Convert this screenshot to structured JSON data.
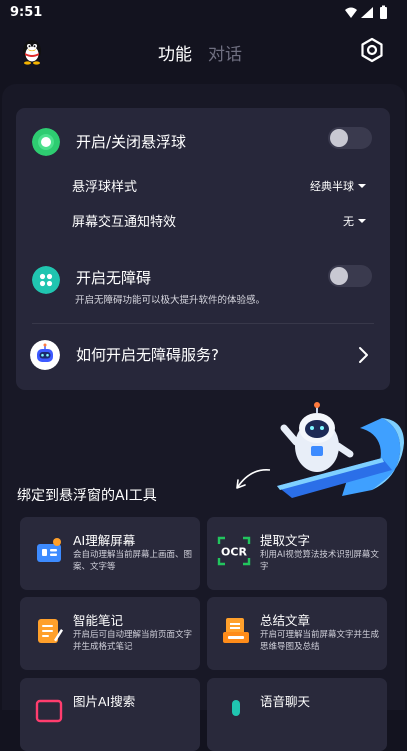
{
  "status_bar": {
    "time": "9:51"
  },
  "header": {
    "tab_function": "功能",
    "tab_chat": "对话"
  },
  "settings": {
    "floating_ball": {
      "title": "开启/关闭悬浮球",
      "enabled": false,
      "style_label": "悬浮球样式",
      "style_value": "经典半球",
      "effect_label": "屏幕交互通知特效",
      "effect_value": "无"
    },
    "accessibility": {
      "title": "开启无障碍",
      "enabled": false,
      "description": "开启无障碍功能可以极大提升软件的体验感。"
    },
    "help": {
      "title": "如何开启无障碍服务?"
    }
  },
  "tools_section": {
    "title": "绑定到悬浮窗的AI工具",
    "items": [
      {
        "name": "AI理解屏幕",
        "desc": "会自动理解当前屏幕上画面、图案、文字等",
        "icon": "screen-understand-icon"
      },
      {
        "name": "提取文字",
        "desc": "利用AI视觉算法技术识别屏幕文字",
        "icon": "ocr-icon",
        "icon_text": "OCR"
      },
      {
        "name": "智能笔记",
        "desc": "开启后可自动理解当前页面文字并生成格式笔记",
        "icon": "note-icon"
      },
      {
        "name": "总结文章",
        "desc": "开启可理解当前屏幕文字并生成思维导图及总结",
        "icon": "summary-icon"
      },
      {
        "name": "图片AI搜索",
        "desc": "",
        "icon": "image-search-icon"
      },
      {
        "name": "语音聊天",
        "desc": "",
        "icon": "voice-chat-icon"
      }
    ]
  },
  "colors": {
    "background": "#13131f",
    "card": "#27273a",
    "accent_green": "#2ecc71",
    "accent_teal": "#20c5b0",
    "icon_blue": "#3d8bff",
    "icon_orange": "#ffa02b"
  }
}
